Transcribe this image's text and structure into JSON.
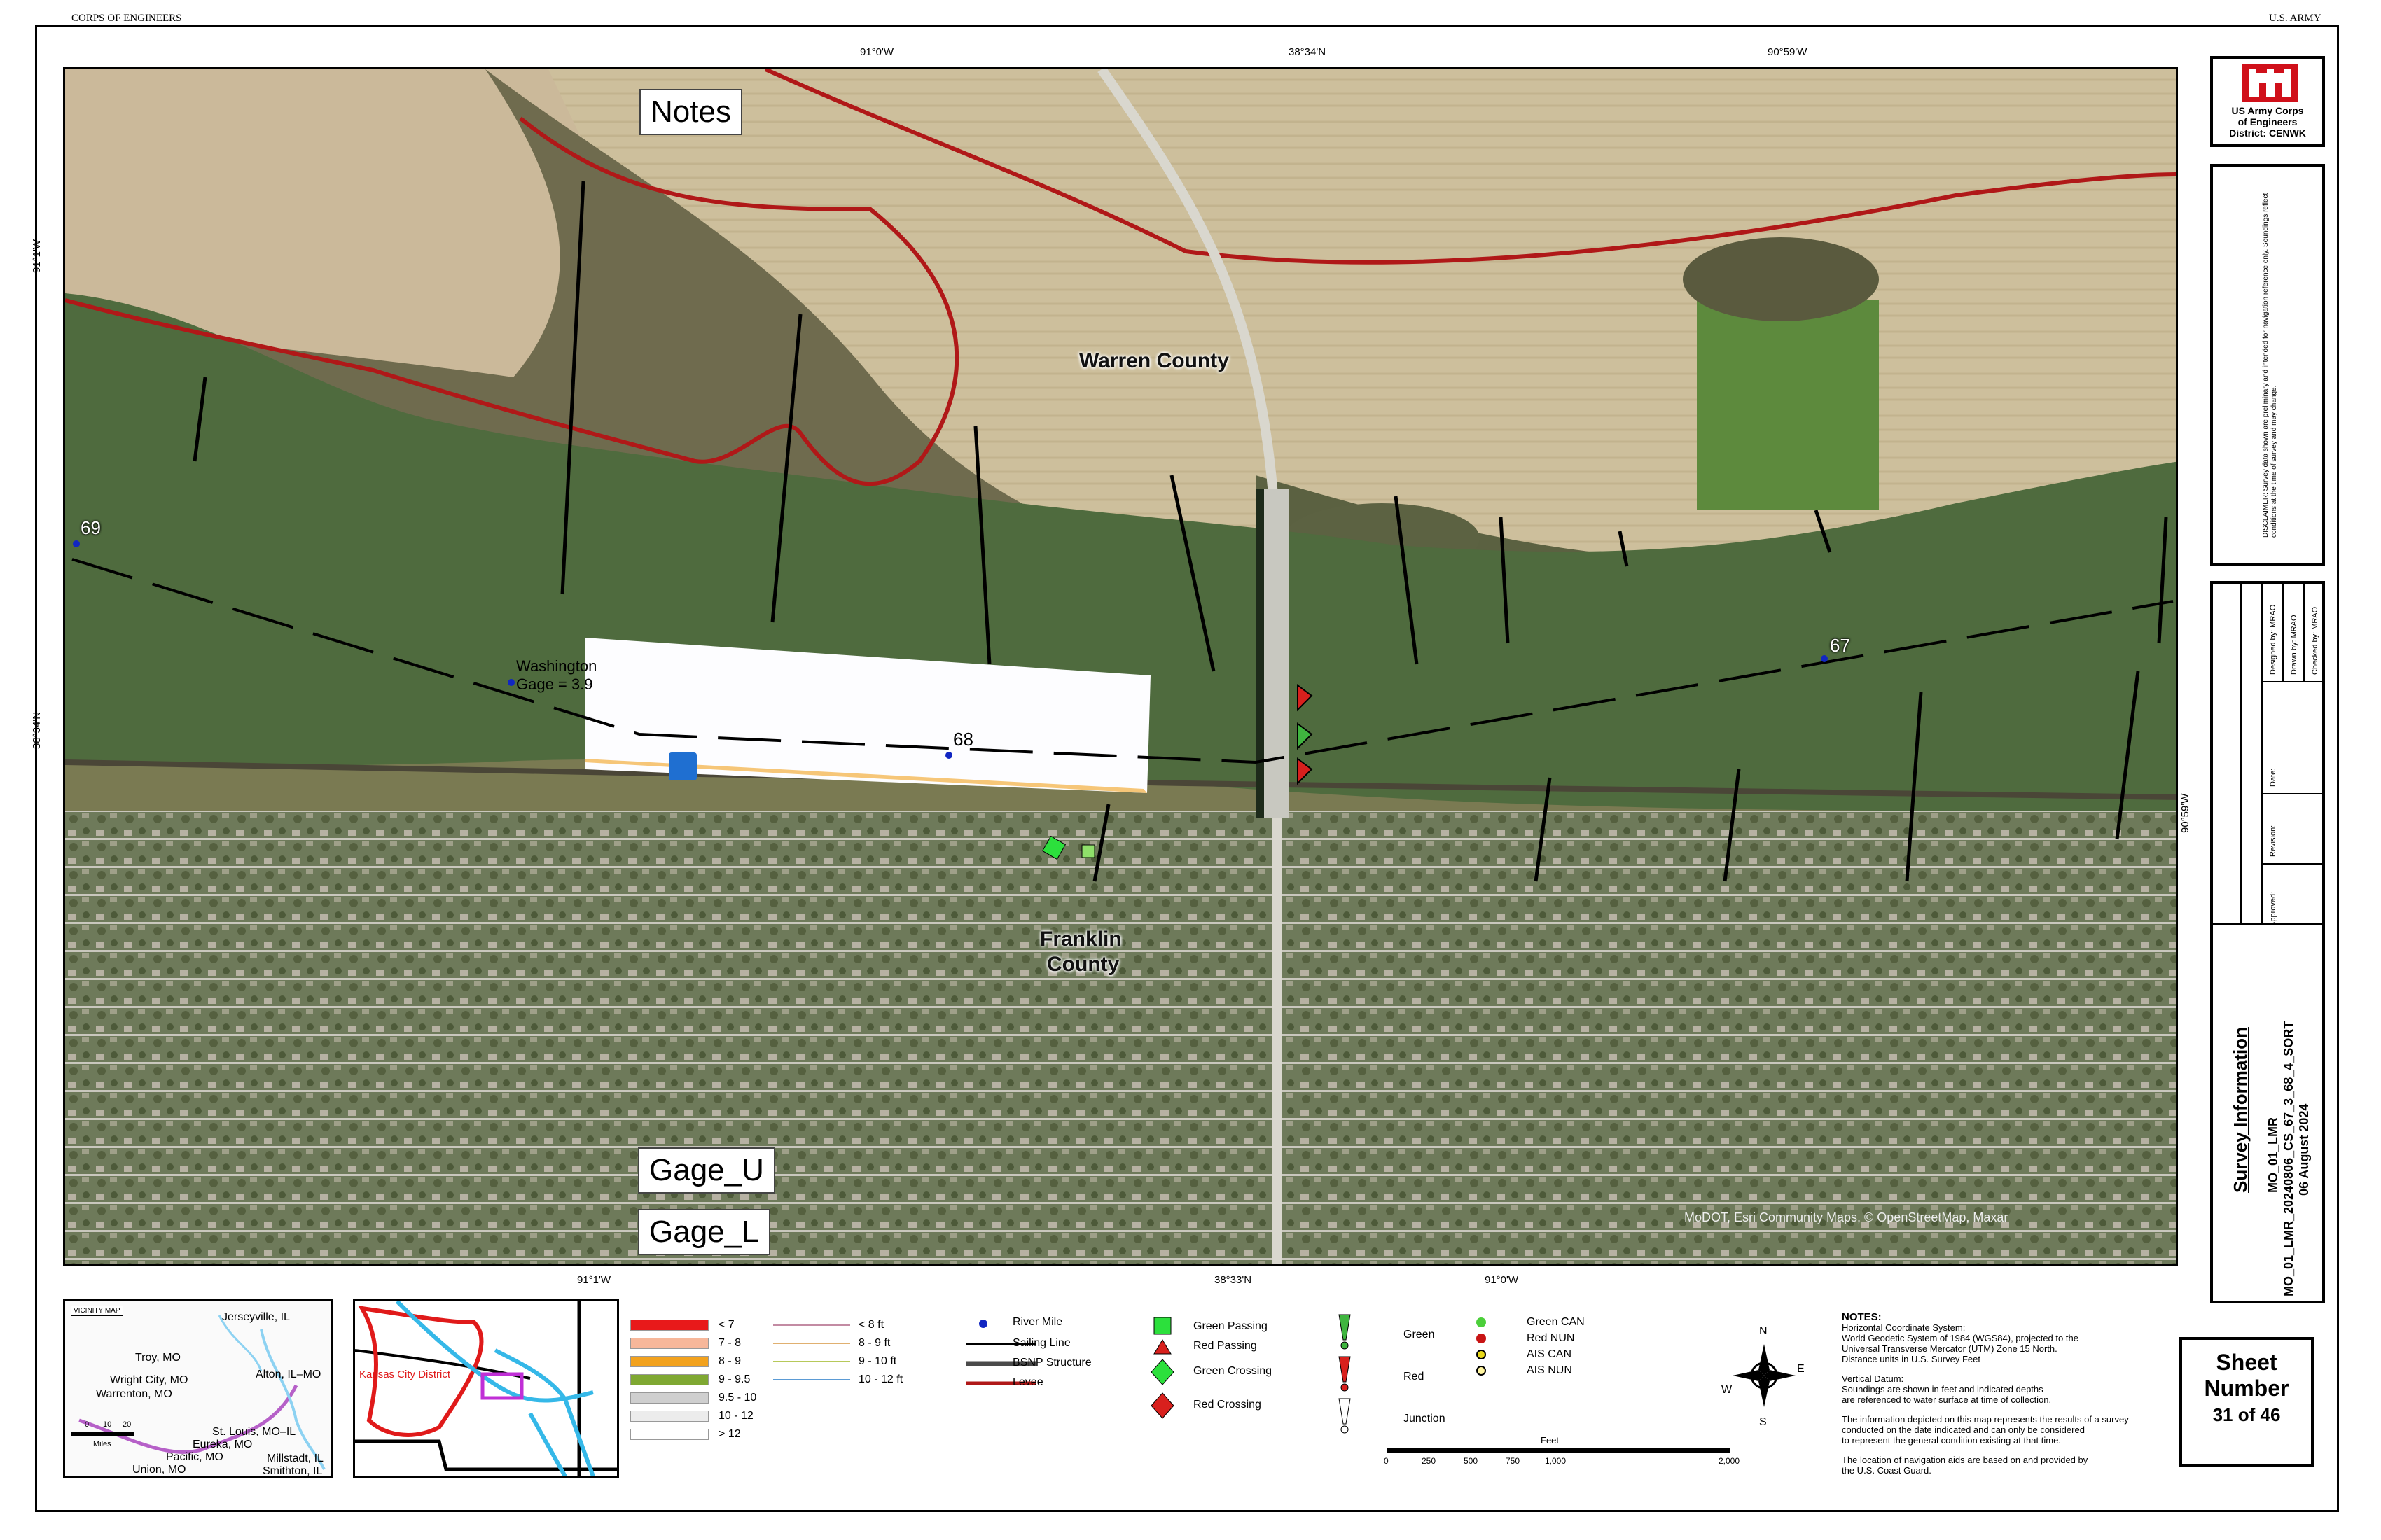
{
  "header": {
    "left": "CORPS OF ENGINEERS",
    "right": "U.S. ARMY"
  },
  "ticks": {
    "top": [
      "91°0'W",
      "38°34'N",
      "90°59'W"
    ],
    "bottom": [
      "91°1'W",
      "38°33'N",
      "91°0'W"
    ],
    "left": [
      "91°1'W",
      "38°34'N"
    ],
    "right": [
      "90°59'W"
    ]
  },
  "map": {
    "notes_label": "Notes",
    "gage_u_label": "Gage_U",
    "gage_l_label": "Gage_L",
    "county_north": "Warren County",
    "county_south_1": "Franklin",
    "county_south_2": "County",
    "gage_name": "Washington",
    "gage_value": "Gage = 3.9",
    "river_miles": [
      "69",
      "68",
      "67"
    ],
    "attribution": "MoDOT, Esri Community Maps, © OpenStreetMap, Maxar"
  },
  "colors": {
    "river": "#4f6b3e",
    "levee": "#b01818",
    "sailing_line": "#000000",
    "farmland": "#cdbf9c",
    "town": "#6b7358"
  },
  "logo": {
    "line1": "US Army Corps",
    "line2": "of Engineers",
    "line3": "District: CENWK"
  },
  "disclaimer": "DISCLAIMER: Survey data shown are preliminary and intended for navigation reference only. Soundings reflect conditions at the time of survey and may change.",
  "signature_block": [
    "Designed by: MRAO",
    "Drawn by: MRAO",
    "Checked by: MRAO",
    "Date:",
    "Revision:",
    "Approved:"
  ],
  "survey_info": {
    "title": "Survey Information",
    "id1": "MO_01_LMR",
    "id2": "MO_01_LMR_20240806_CS_67_3_68_4_SORT",
    "date": "06 August 2024"
  },
  "sheet": {
    "label1": "Sheet",
    "label2": "Number",
    "value": "31 of 46"
  },
  "vicinity": {
    "title": "VICINITY MAP",
    "places": [
      "Jerseyville, IL",
      "Troy, MO",
      "Alton, IL–MO",
      "Wright City, MO",
      "Warrenton, MO",
      "St. Louis, MO–IL",
      "Eureka, MO",
      "Pacific, MO",
      "Union, MO",
      "Millstadt, IL",
      "Smithton, IL"
    ],
    "scale": [
      "0",
      "10",
      "20"
    ],
    "scale_unit": "Miles"
  },
  "district_map": {
    "label": "Kansas City District"
  },
  "legend": {
    "depth_a": [
      {
        "label": "< 7",
        "color": "#e8191a"
      },
      {
        "label": "7 - 8",
        "color": "#f7b79a"
      },
      {
        "label": "8 - 9",
        "color": "#f2a21e"
      },
      {
        "label": "9 - 9.5",
        "color": "#7fa832"
      },
      {
        "label": "9.5 - 10",
        "color": "#cfcfcf"
      },
      {
        "label": "10 - 12",
        "color": "#ececec"
      },
      {
        "label": "> 12",
        "color": "#ffffff"
      }
    ],
    "depth_b": [
      {
        "label": "< 8 ft",
        "color": "#c38ba3"
      },
      {
        "label": "8 - 9 ft",
        "color": "#e0b070"
      },
      {
        "label": "9 - 10 ft",
        "color": "#b7c95a"
      },
      {
        "label": "10 - 12 ft",
        "color": "#5b9bd5"
      }
    ],
    "features": [
      "River Mile",
      "Sailing Line",
      "BSNP Structure",
      "Levee"
    ],
    "markers": [
      "Green Passing",
      "Red Passing",
      "Green Crossing",
      "Red Crossing"
    ],
    "buoys": [
      "Green",
      "Red",
      "Junction"
    ],
    "cans": [
      "Green CAN",
      "Red NUN",
      "AIS CAN",
      "AIS NUN"
    ]
  },
  "scalebar": {
    "title": "Feet",
    "ticks": [
      "0",
      "250",
      "500",
      "750",
      "1,000",
      "2,000"
    ]
  },
  "notes": {
    "title": "NOTES:",
    "lines": [
      "Horizontal Coordinate System:",
      "World Geodetic System of 1984 (WGS84), projected to the",
      "Universal Transverse Mercator (UTM) Zone 15 North.",
      "Distance units in U.S. Survey Feet",
      "",
      "Vertical Datum:",
      "Soundings are shown in feet and indicated depths",
      "are referenced to water surface at time of collection.",
      "",
      "The information depicted on this map represents the results of a survey",
      "conducted on the date indicated and can only be considered",
      "to represent the general condition existing at that time.",
      "",
      "The location of navigation aids are based on and provided by",
      "the U.S. Coast Guard."
    ]
  }
}
